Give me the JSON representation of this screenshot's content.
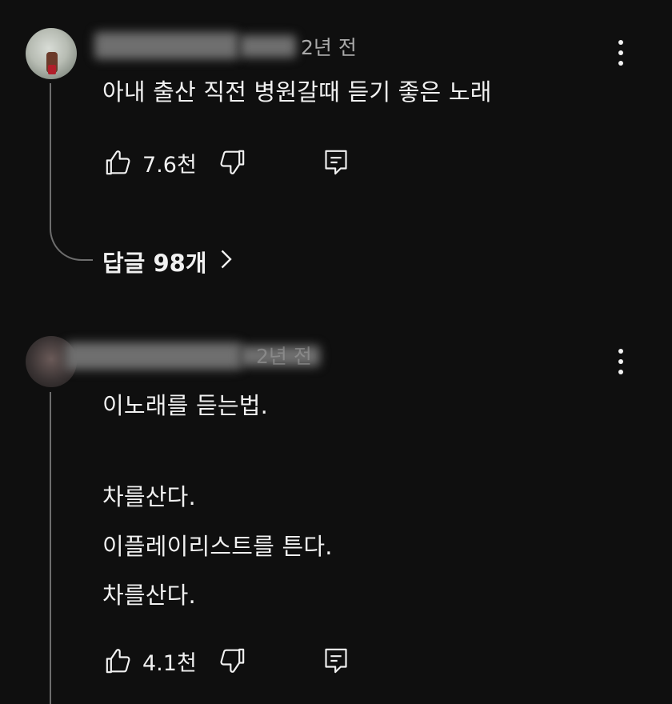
{
  "comments": [
    {
      "author_visible": "리슨",
      "time": "2년 전",
      "text_lines": [
        "아내 출산 직전 병원갈때 듣기 좋은 노래"
      ],
      "likes": "7.6천",
      "replies_label": "답글 98개"
    },
    {
      "author_visible": "",
      "time": "2년 전",
      "text_lines": [
        "이노래를 듣는법.",
        "",
        "차를산다.",
        "이플레이리스트를 튼다.",
        "차를산다."
      ],
      "likes": "4.1천"
    }
  ],
  "icons": {
    "like": "thumbs-up-icon",
    "dislike": "thumbs-down-icon",
    "reply": "comment-reply-icon",
    "more": "more-vertical-icon",
    "chevron": "chevron-right-icon"
  },
  "colors": {
    "background": "#0f0f0f",
    "text": "#f1f1f1",
    "secondary_text": "#a9a9a9",
    "thread_line": "#6d6d6d"
  }
}
